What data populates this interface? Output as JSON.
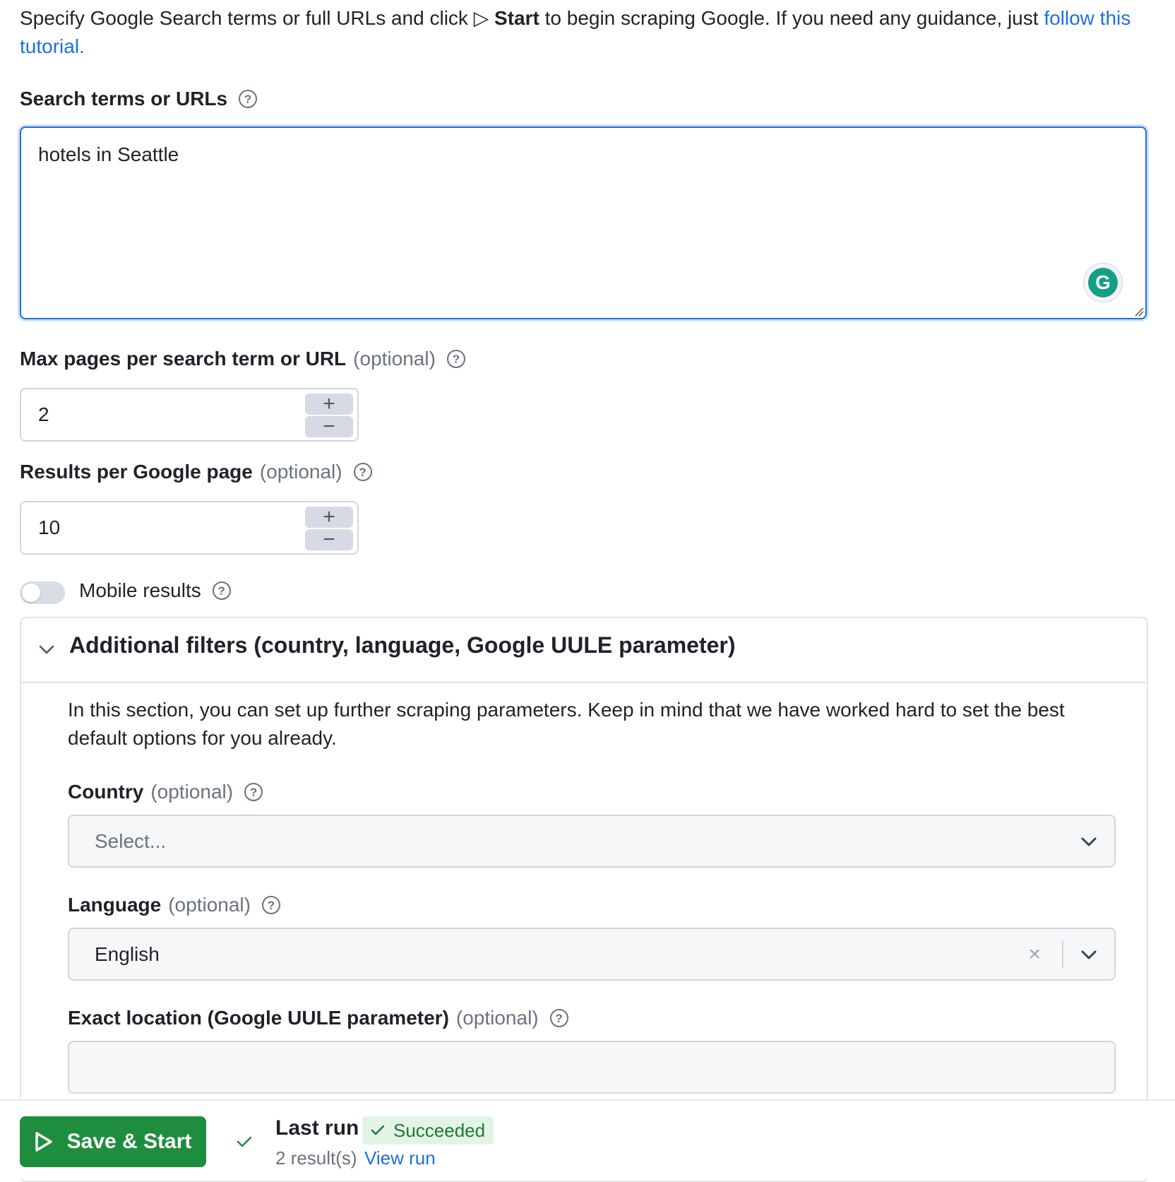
{
  "intro": {
    "text_before": "Specify Google Search terms or full URLs and click",
    "play_glyph": "▷",
    "start_word": "Start",
    "text_after": "to begin scraping Google. If you need any guidance, just",
    "link_text": "follow this tutorial."
  },
  "search": {
    "label": "Search terms or URLs",
    "value": "hotels in Seattle",
    "help_icon": "help-circle-icon",
    "grammarly_letter": "G"
  },
  "max_pages": {
    "label": "Max pages per search term or URL",
    "optional": "(optional)",
    "value": "2"
  },
  "results_per_page": {
    "label": "Results per Google page",
    "optional": "(optional)",
    "value": "10"
  },
  "stepper": {
    "plus": "+",
    "minus": "−"
  },
  "mobile": {
    "label": "Mobile results",
    "enabled": false
  },
  "filters": {
    "title": "Additional filters (country, language, Google UULE parameter)",
    "expanded": true,
    "description": "In this section, you can set up further scraping parameters. Keep in mind that we have worked hard to set the best default options for you already.",
    "country": {
      "label": "Country",
      "optional": "(optional)",
      "placeholder": "Select..."
    },
    "language": {
      "label": "Language",
      "optional": "(optional)",
      "value": "English",
      "clear": "×"
    },
    "uule": {
      "label": "Exact location (Google UULE parameter)",
      "optional": "(optional)",
      "value": ""
    }
  },
  "footer": {
    "start_button": "Save & Start",
    "last_run_label": "Last run",
    "status": "Succeeded",
    "results": "2 result(s)",
    "view_run": "View run"
  },
  "colors": {
    "accent": "#1f6fde",
    "success": "#1e8e3e",
    "success_bg": "#e3f4e7",
    "grammarly": "#15a085"
  }
}
